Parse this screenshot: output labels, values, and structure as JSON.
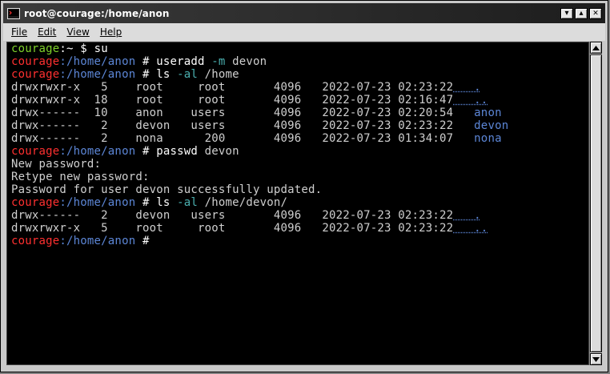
{
  "window": {
    "title": "root@courage:/home/anon"
  },
  "menu": [
    {
      "label": "File"
    },
    {
      "label": "Edit"
    },
    {
      "label": "View"
    },
    {
      "label": "Help"
    }
  ],
  "titlebar_buttons": [
    {
      "icon": "minimize-icon",
      "glyph": "▾"
    },
    {
      "icon": "maximize-icon",
      "glyph": "▴"
    },
    {
      "icon": "close-icon",
      "glyph": "✕"
    }
  ],
  "terminal": {
    "prompt_user_host": "courage",
    "lines": [
      {
        "kind": "prompt_user",
        "host": "courage",
        "path": ":~",
        "sym": " $ ",
        "cmd": "su",
        "args": ""
      },
      {
        "kind": "prompt_root",
        "host": "courage",
        "path": ":/home/anon",
        "sym": " # ",
        "cmd": "useradd",
        "flag": " -m",
        "args": " devon"
      },
      {
        "kind": "prompt_root",
        "host": "courage",
        "path": ":/home/anon",
        "sym": " # ",
        "cmd": "ls",
        "flag": " -al",
        "args": " /home"
      },
      {
        "kind": "ls",
        "perm": "drwxrwxr-x",
        "links": "5",
        "owner": "root",
        "group": "root",
        "size": "4096",
        "date": "2022-07-23",
        "time": "02:23:22",
        "name": "."
      },
      {
        "kind": "ls",
        "perm": "drwxrwxr-x",
        "links": "18",
        "owner": "root",
        "group": "root",
        "size": "4096",
        "date": "2022-07-23",
        "time": "02:16:47",
        "name": ".."
      },
      {
        "kind": "ls",
        "perm": "drwx------",
        "links": "10",
        "owner": "anon",
        "group": "users",
        "size": "4096",
        "date": "2022-07-23",
        "time": "02:20:54",
        "name": "anon"
      },
      {
        "kind": "ls",
        "perm": "drwx------",
        "links": "2",
        "owner": "devon",
        "group": "users",
        "size": "4096",
        "date": "2022-07-23",
        "time": "02:23:22",
        "name": "devon"
      },
      {
        "kind": "ls",
        "perm": "drwx------",
        "links": "2",
        "owner": "nona",
        "group": "200",
        "size": "4096",
        "date": "2022-07-23",
        "time": "01:34:07",
        "name": "nona"
      },
      {
        "kind": "prompt_root",
        "host": "courage",
        "path": ":/home/anon",
        "sym": " # ",
        "cmd": "passwd",
        "flag": "",
        "args": " devon"
      },
      {
        "kind": "text",
        "text": "New password:"
      },
      {
        "kind": "text",
        "text": "Retype new password:"
      },
      {
        "kind": "text",
        "text": "Password for user devon successfully updated."
      },
      {
        "kind": "prompt_root",
        "host": "courage",
        "path": ":/home/anon",
        "sym": " # ",
        "cmd": "ls",
        "flag": " -al",
        "args": " /home/devon/"
      },
      {
        "kind": "ls",
        "perm": "drwx------",
        "links": "2",
        "owner": "devon",
        "group": "users",
        "size": "4096",
        "date": "2022-07-23",
        "time": "02:23:22",
        "name": "."
      },
      {
        "kind": "ls",
        "perm": "drwxrwxr-x",
        "links": "5",
        "owner": "root",
        "group": "root",
        "size": "4096",
        "date": "2022-07-23",
        "time": "02:23:22",
        "name": ".."
      },
      {
        "kind": "prompt_root",
        "host": "courage",
        "path": ":/home/anon",
        "sym": " # ",
        "cmd": "",
        "flag": "",
        "args": ""
      }
    ]
  },
  "colors": {
    "user_host": "#7fd32a",
    "root_host": "#ff3030",
    "path": "#5c86d6",
    "flag": "#4bb0b0",
    "dir_name": "#5c86d6"
  }
}
